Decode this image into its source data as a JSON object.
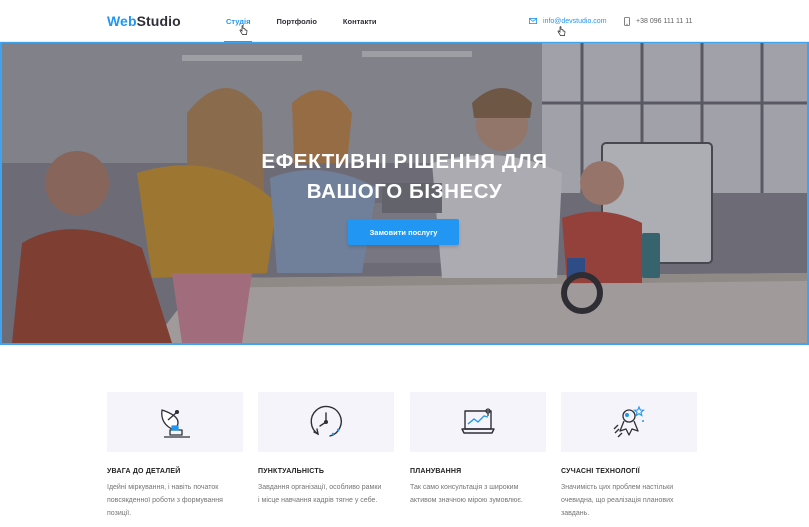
{
  "header": {
    "logo": {
      "part1": "Web",
      "part2": "Studio"
    },
    "nav": [
      {
        "label": "Студія"
      },
      {
        "label": "Портфоліо"
      },
      {
        "label": "Контакти"
      }
    ],
    "email": "info@devstudio.com",
    "phone": "+38 096 111 11 11",
    "current_nav": "Студія"
  },
  "hero": {
    "title_line1": "Ефективні рішення для",
    "title_line2": "вашого бізнесу",
    "button_label": "Замовити послугу"
  },
  "features": [
    {
      "icon": "satellite-dish-icon",
      "title": "Увага до деталей",
      "text": [
        "Ідейні міркування, і навіть початок",
        "повсякденної роботи з формування",
        "позиції."
      ]
    },
    {
      "icon": "clock-icon",
      "title": "Пунктуальність",
      "text": [
        "Завдання організації, особливо рамки",
        "і місце навчання кадрів тягне у себе."
      ]
    },
    {
      "icon": "analytics-laptop-icon",
      "title": "Планування",
      "text": [
        "Так само консультація з широким",
        "активом значною мірою зумовлює."
      ]
    },
    {
      "icon": "astronaut-icon",
      "title": "Сучасні технології",
      "text": [
        "Значимість цих проблем настільки",
        "очевидна, що реалізація планових",
        "завдань."
      ]
    }
  ],
  "colors": {
    "accent": "#2196f3",
    "text_dark": "#2f2f37",
    "text_muted": "#757575",
    "feature_bg": "#f5f4fa"
  }
}
